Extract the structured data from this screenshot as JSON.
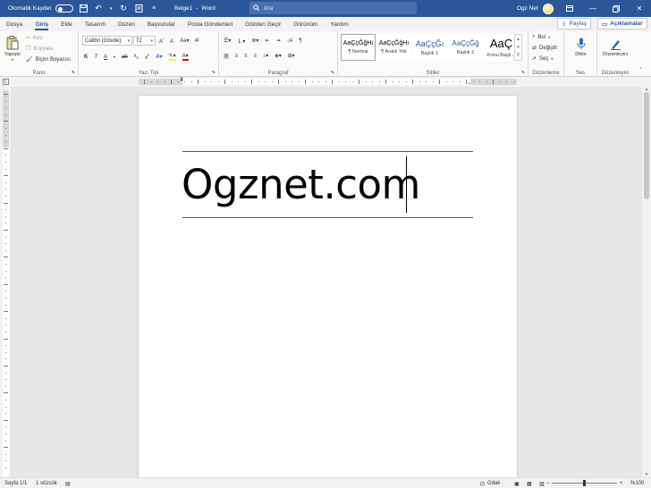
{
  "titlebar": {
    "autosave_label": "Otomatik Kaydet",
    "doc_name": "Belge1",
    "separator": "-",
    "app_name": "Word",
    "search_placeholder": "Ara",
    "user_name": "Ogz Net",
    "bg_color": "#2b579a"
  },
  "tabs": [
    {
      "label": "Dosya",
      "active": false
    },
    {
      "label": "Giriş",
      "active": true
    },
    {
      "label": "Ekle",
      "active": false
    },
    {
      "label": "Tasarım",
      "active": false
    },
    {
      "label": "Düzen",
      "active": false
    },
    {
      "label": "Başvurular",
      "active": false
    },
    {
      "label": "Posta Gönderileri",
      "active": false
    },
    {
      "label": "Gözden Geçir",
      "active": false
    },
    {
      "label": "Görünüm",
      "active": false
    },
    {
      "label": "Yardım",
      "active": false
    }
  ],
  "share_label": "Paylaş",
  "comments_label": "Açıklamalar",
  "groups": {
    "clipboard": {
      "label": "Pano",
      "paste": "Yapıştır",
      "cut": "Kes",
      "copy": "Kopyala",
      "format_painter": "Biçim Boyacısı"
    },
    "font": {
      "label": "Yazı Tipi",
      "font_name": "Calibri (Gövde)",
      "font_size": "72"
    },
    "paragraph": {
      "label": "Paragraf"
    },
    "styles": {
      "label": "Stiller",
      "items": [
        {
          "sample": "AaÇçĞğHı",
          "name": "¶ Normal",
          "selected": true
        },
        {
          "sample": "AaÇçĞğHı",
          "name": "¶ Aralık Yok",
          "selected": false
        },
        {
          "sample": "AaÇçĞı",
          "name": "Başlık 1",
          "selected": false
        },
        {
          "sample": "AaÇçĞğ",
          "name": "Başlık 2",
          "selected": false
        },
        {
          "sample": "AaÇ",
          "name": "Konu Başlı...",
          "selected": false
        }
      ]
    },
    "editing": {
      "label": "Düzenleme",
      "find": "Bul",
      "replace": "Değiştir",
      "select": "Seç"
    },
    "voice": {
      "label": "Ses",
      "dictate": "Dikte"
    },
    "editor": {
      "label": "Düzenleyici",
      "editor_btn": "Düzenleyici"
    }
  },
  "document": {
    "text": "Ogznet.com"
  },
  "statusbar": {
    "page": "Sayfa 1/1",
    "words": "1 sözcük",
    "focus": "Odak",
    "zoom": "%100"
  }
}
